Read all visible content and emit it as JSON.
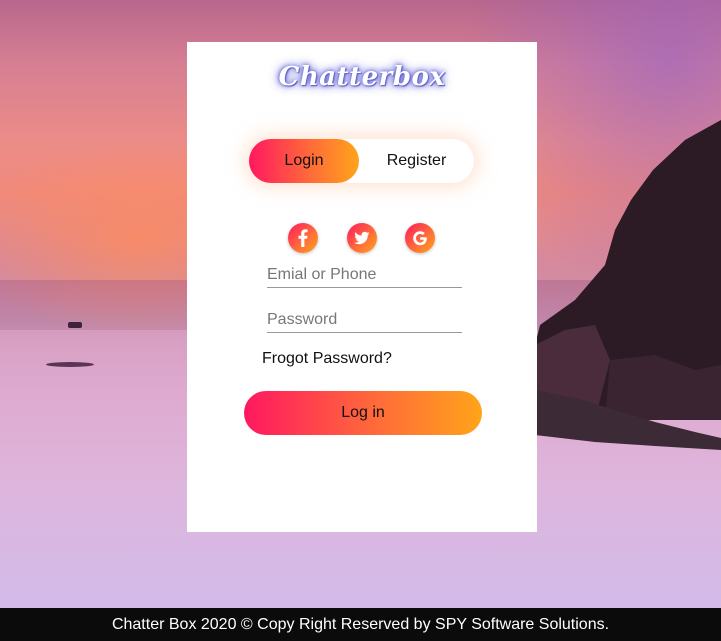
{
  "app": {
    "brand": "Chatterbox"
  },
  "auth_toggle": {
    "login_label": "Login",
    "register_label": "Register",
    "active": "Login"
  },
  "social_login": {
    "icons": [
      "facebook-icon",
      "twitter-icon",
      "google-icon"
    ]
  },
  "form": {
    "email_placeholder": "Emial or Phone",
    "email_value": "",
    "password_placeholder": "Password",
    "password_value": "",
    "forgot_label": "Frogot Password?",
    "submit_label": "Log in"
  },
  "footer": {
    "text": "Chatter Box 2020 © Copy Right Reserved by SPY Software Solutions."
  },
  "colors": {
    "gradient_start": "#ff1860",
    "gradient_end": "#ffa41a",
    "card": "#ffffff",
    "footer": "#0b0b0b"
  }
}
